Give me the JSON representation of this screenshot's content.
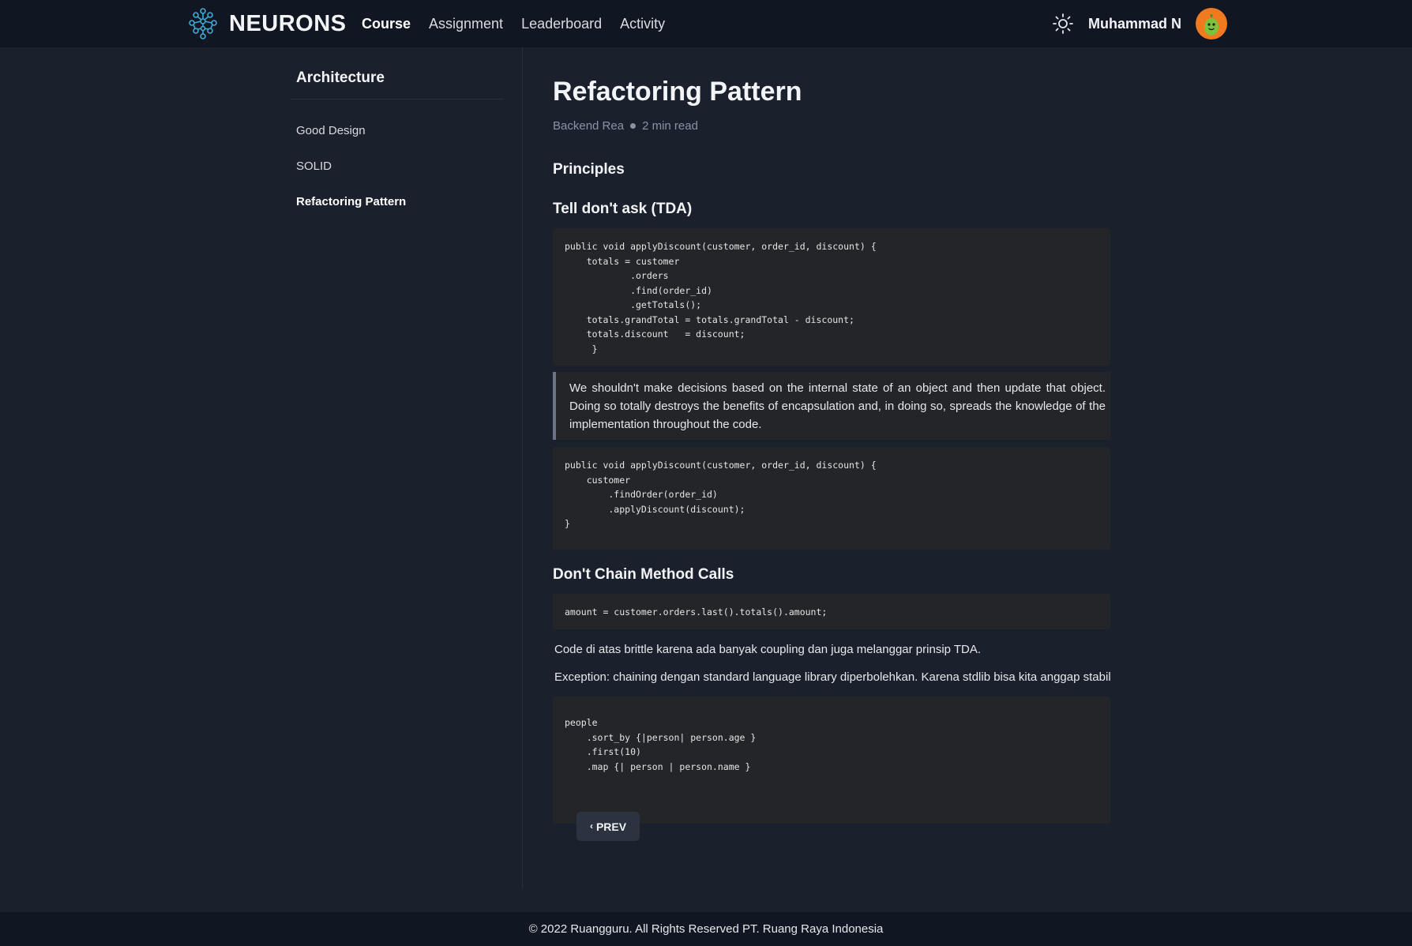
{
  "brand": {
    "name": "NEURONS",
    "logo_icon": "neuron-network-icon"
  },
  "nav": {
    "items": [
      {
        "label": "Course",
        "active": true
      },
      {
        "label": "Assignment",
        "active": false
      },
      {
        "label": "Leaderboard",
        "active": false
      },
      {
        "label": "Activity",
        "active": false
      }
    ]
  },
  "header": {
    "theme_icon": "sun-icon",
    "user_name": "Muhammad N",
    "avatar_color": "#f07a1f"
  },
  "sidebar": {
    "title": "Architecture",
    "items": [
      {
        "label": "Good Design",
        "active": false
      },
      {
        "label": "SOLID",
        "active": false
      },
      {
        "label": "Refactoring Pattern",
        "active": true
      }
    ]
  },
  "article": {
    "title": "Refactoring Pattern",
    "author": "Backend Rea",
    "read_time": "2 min read",
    "sections": {
      "principles": "Principles",
      "tda": "Tell don't ask (TDA)",
      "chain": "Don't Chain Method Calls"
    },
    "code1": "public void applyDiscount(customer, order_id, discount) {\n    totals = customer\n            .orders\n            .find(order_id)\n            .getTotals();\n    totals.grandTotal = totals.grandTotal - discount;\n    totals.discount   = discount;\n     }",
    "quote": "We shouldn't make decisions based on the internal state of an object and then update that object. Doing so totally destroys the benefits of encapsulation and, in doing so, spreads the knowledge of the implementation throughout the code.",
    "code2": "public void applyDiscount(customer, order_id, discount) {\n    customer\n        .findOrder(order_id)\n        .applyDiscount(discount);\n}",
    "code3": "amount = customer.orders.last().totals().amount;",
    "para1": "Code di atas brittle karena ada banyak coupling dan juga melanggar prinsip TDA.",
    "para2": "Exception: chaining dengan standard language library diperbolehkan. Karena stdlib bisa kita anggap stabil",
    "code4": "people\n    .sort_by {|person| person.age }\n    .first(10)\n    .map {| person | person.name }",
    "prev_label": "PREV"
  },
  "footer": {
    "text": "© 2022 Ruangguru. All Rights Reserved PT. Ruang Raya Indonesia"
  }
}
